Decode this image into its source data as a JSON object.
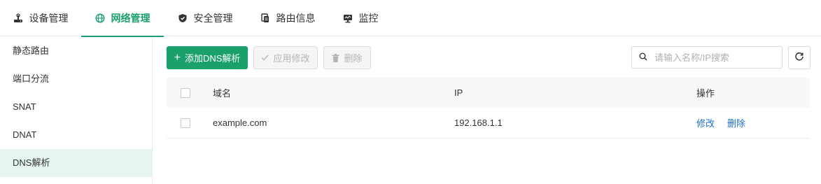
{
  "topnav": {
    "tabs": [
      {
        "label": "设备管理",
        "icon": "device-icon"
      },
      {
        "label": "网络管理",
        "icon": "globe-icon",
        "active": true
      },
      {
        "label": "安全管理",
        "icon": "shield-icon"
      },
      {
        "label": "路由信息",
        "icon": "document-icon"
      },
      {
        "label": "监控",
        "icon": "monitor-icon"
      }
    ]
  },
  "sidebar": {
    "items": [
      {
        "label": "静态路由"
      },
      {
        "label": "端口分流"
      },
      {
        "label": "SNAT"
      },
      {
        "label": "DNAT"
      },
      {
        "label": "DNS解析",
        "active": true
      }
    ]
  },
  "toolbar": {
    "add_label": "添加DNS解析",
    "apply_label": "应用修改",
    "delete_label": "删除",
    "search_placeholder": "请输入名称/IP搜索"
  },
  "table": {
    "columns": [
      "域名",
      "IP",
      "操作"
    ],
    "rows": [
      {
        "domain": "example.com",
        "ip": "192.168.1.1",
        "actions": [
          "修改",
          "删除"
        ]
      }
    ]
  },
  "colors": {
    "accent": "#1aa06a",
    "link": "#1f6fd0",
    "sidebar_active_bg": "#e6f6ef"
  }
}
